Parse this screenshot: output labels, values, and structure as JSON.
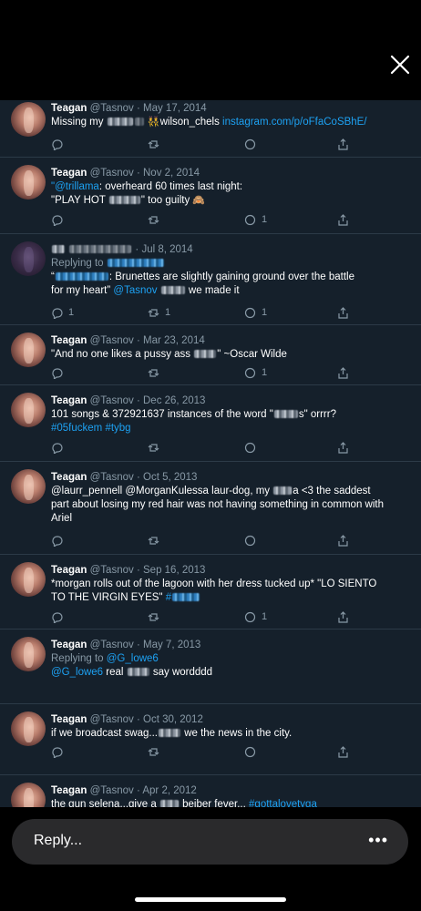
{
  "viewer": {
    "close_icon": "close-icon"
  },
  "tweets": [
    {
      "name": "Teagan",
      "handle": "@Tasnov",
      "sep": "·",
      "date": "May 17, 2014",
      "t1": "Missing my",
      "t2": "wilson_chels",
      "link": "instagram.com/p/oFfaCoSBhE/",
      "emoji": "👯",
      "like_count": "",
      "retweet_count": ""
    },
    {
      "name": "Teagan",
      "handle": "@Tasnov",
      "sep": "·",
      "date": "Nov 2, 2014",
      "mention": "\"@trillama",
      "t1": ": overheard 60 times last night:",
      "t2": "\"PLAY HOT",
      "t3": "\" too guilty",
      "emoji": "🙈",
      "like_count": "1"
    },
    {
      "date": "Jul 8, 2014",
      "replying_label": "Replying to",
      "t1": "“",
      "t2": ": Brunettes are slightly gaining ground over the battle",
      "t3": "for my heart”",
      "mention": "@Tasnov",
      "t4": "we made it",
      "reply_count": "1",
      "retweet_count": "1",
      "like_count": "1"
    },
    {
      "name": "Teagan",
      "handle": "@Tasnov",
      "sep": "·",
      "date": "Mar 23, 2014",
      "t1": "\"And no one likes a pussy ass",
      "t2": "\" ~Oscar Wilde",
      "like_count": "1"
    },
    {
      "name": "Teagan",
      "handle": "@Tasnov",
      "sep": "·",
      "date": "Dec 26, 2013",
      "t1": "101 songs & 372921637 instances of the word \"",
      "t2": "s\" orrrr?",
      "hashtags": "#05fuckem #tybg"
    },
    {
      "name": "Teagan",
      "handle": "@Tasnov",
      "sep": "·",
      "date": "Oct 5, 2013",
      "t1": "@laurr_pennell @MorganKulessa laur-dog, my",
      "t2": "a <3 the saddest",
      "t3": "part about losing my red hair was not having something in common with",
      "t4": "Ariel"
    },
    {
      "name": "Teagan",
      "handle": "@Tasnov",
      "sep": "·",
      "date": "Sep 16, 2013",
      "t1": "*morgan rolls out of the lagoon with her dress tucked up* \"LO SIENTO",
      "t2": "TO THE VIRGIN EYES\"",
      "tag": "#",
      "like_count": "1"
    },
    {
      "name": "Teagan",
      "handle": "@Tasnov",
      "sep": "·",
      "date": "May 7, 2013",
      "replying_label": "Replying to",
      "replying_to": "@G_lowe6",
      "mention": "@G_lowe6",
      "t1": "real",
      "t2": "say wordddd"
    },
    {
      "name": "Teagan",
      "handle": "@Tasnov",
      "sep": "·",
      "date": "Oct 30, 2012",
      "t1": "if we broadcast swag...",
      "t2": "we the news in the city."
    },
    {
      "name": "Teagan",
      "handle": "@Tasnov",
      "sep": "·",
      "date": "Apr 2, 2012",
      "t1": "the gun selena...give a",
      "t2": "beiber fever...",
      "hashtag": "#gottalovetyga"
    }
  ],
  "reply_bar": {
    "placeholder": "Reply...",
    "more_label": "•••"
  },
  "colors": {
    "background": "#15202b",
    "link": "#1da1f2",
    "muted": "#8899a6"
  },
  "icons": [
    "reply-icon",
    "retweet-icon",
    "like-icon",
    "share-icon",
    "close-icon"
  ]
}
